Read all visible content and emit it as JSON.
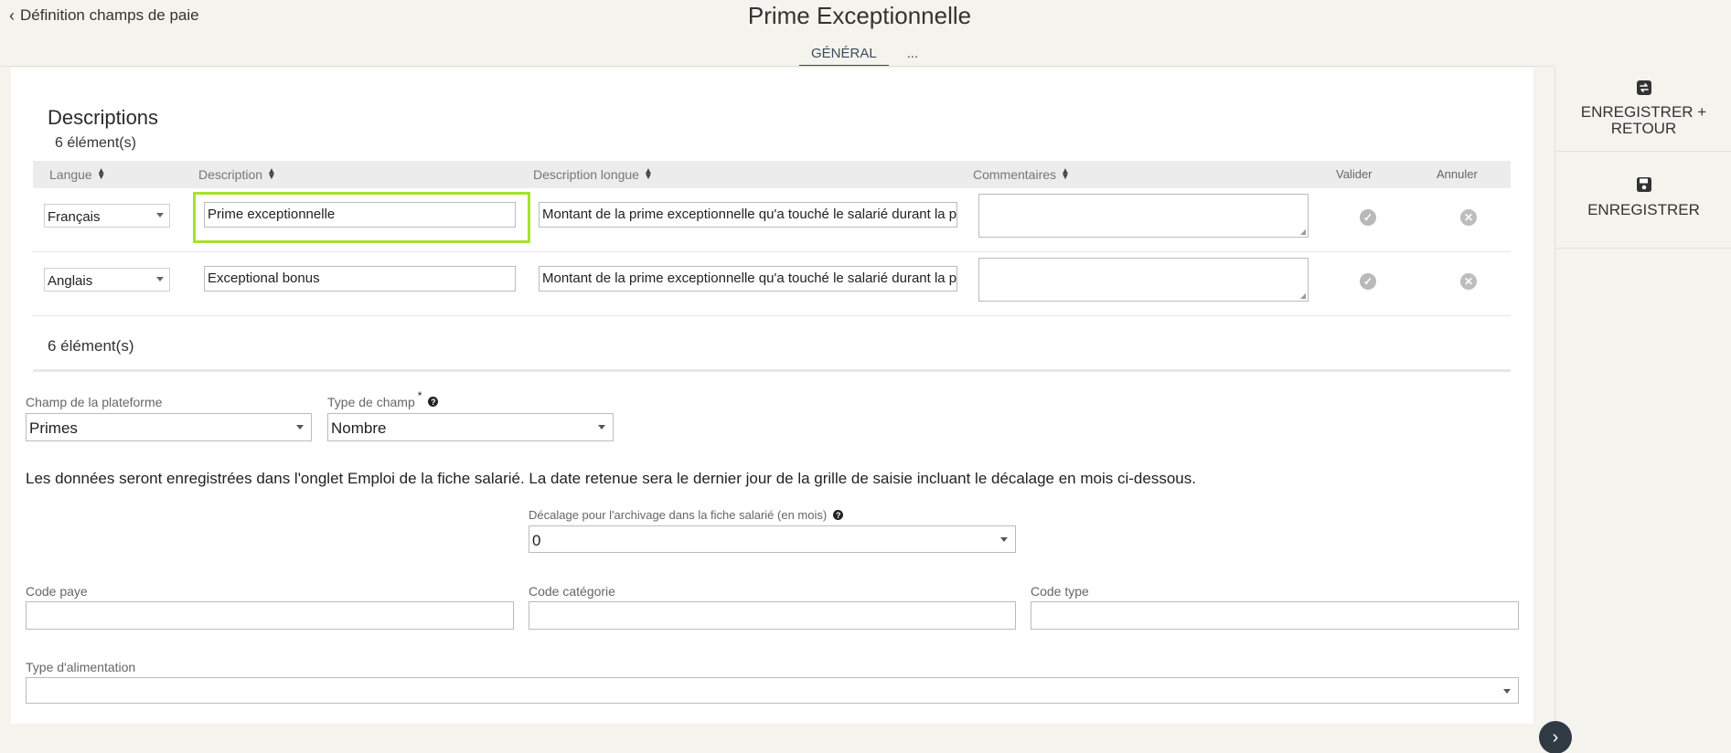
{
  "header": {
    "back_label": "Définition champs de paie",
    "title": "Prime Exceptionnelle",
    "tabs": [
      {
        "label": "GÉNÉRAL",
        "active": true
      },
      {
        "label": "..."
      }
    ]
  },
  "descriptions": {
    "title": "Descriptions",
    "count_label": "6 élément(s)",
    "columns": {
      "langue": "Langue",
      "description": "Description",
      "description_longue": "Description longue",
      "commentaires": "Commentaires",
      "valider": "Valider",
      "annuler": "Annuler"
    },
    "rows": [
      {
        "langue": "Français",
        "description": "Prime exceptionnelle",
        "description_longue": "Montant de la prime exceptionnelle qu'a touché le salarié durant la pé",
        "commentaires": ""
      },
      {
        "langue": "Anglais",
        "description": "Exceptional bonus",
        "description_longue": "Montant de la prime exceptionnelle qu'a touché le salarié durant la pé",
        "commentaires": ""
      }
    ],
    "count_label_bottom": "6 élément(s)"
  },
  "form": {
    "champ_plateforme": {
      "label": "Champ de la plateforme",
      "value": "Primes"
    },
    "type_champ": {
      "label": "Type de champ",
      "required_mark": "*",
      "value": "Nombre"
    },
    "info_text": "Les données seront enregistrées dans l'onglet Emploi de la fiche salarié. La date retenue sera le dernier jour de la grille de saisie incluant le décalage en mois ci-dessous.",
    "decalage": {
      "label": "Décalage pour l'archivage dans la fiche salarié (en mois)",
      "value": "0"
    },
    "code_paye": {
      "label": "Code paye",
      "value": ""
    },
    "code_categorie": {
      "label": "Code catégorie",
      "value": ""
    },
    "code_type": {
      "label": "Code type",
      "value": ""
    },
    "type_alimentation": {
      "label": "Type d'alimentation",
      "value": ""
    }
  },
  "actions": {
    "save_return_label": "ENREGISTRER + RETOUR",
    "save_label": "ENREGISTRER"
  },
  "icons": {
    "back": "chevron-left-icon",
    "sort": "sort-icon",
    "validate": "check-icon",
    "cancel": "close-icon",
    "help": "question-icon",
    "save_return": "save-return-icon",
    "save": "floppy-disk-icon",
    "next": "chevron-right-icon"
  }
}
